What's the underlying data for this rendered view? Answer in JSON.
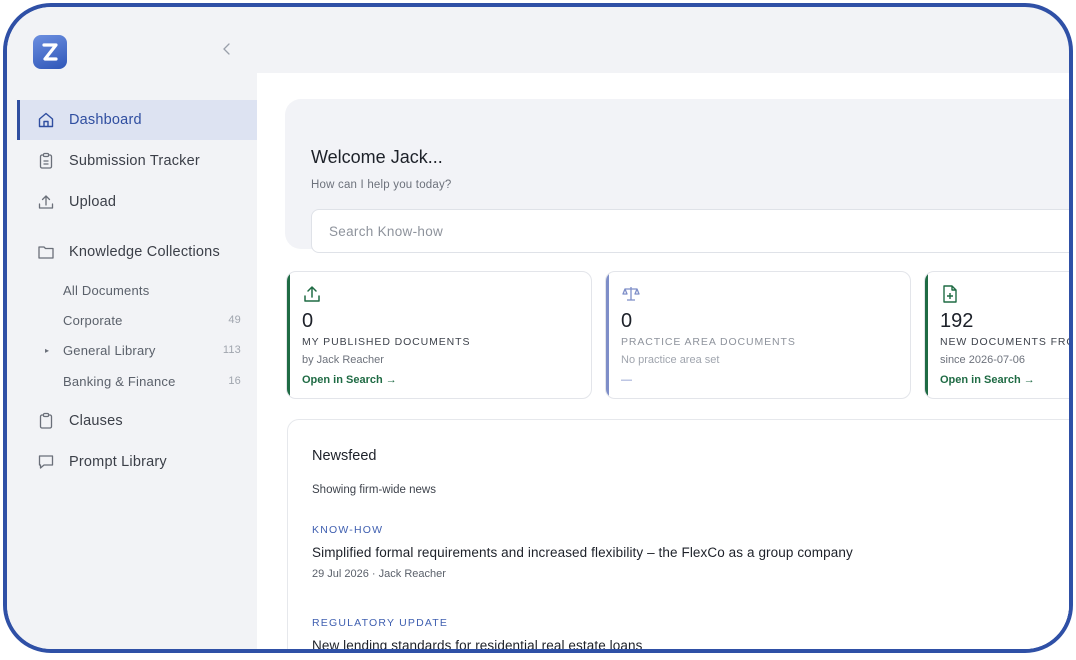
{
  "app": {
    "logo_text": "Z",
    "collapse_icon": "chevron-left-icon"
  },
  "sidebar": {
    "nav": [
      {
        "label": "Dashboard",
        "icon": "home-icon",
        "active": true
      },
      {
        "label": "Submission Tracker",
        "icon": "clipboard-icon"
      },
      {
        "label": "Upload",
        "icon": "upload-icon"
      },
      {
        "label": "Knowledge Collections",
        "icon": "folder-icon"
      }
    ],
    "collections": [
      {
        "label": "All Documents",
        "count": ""
      },
      {
        "label": "Corporate",
        "count": "49"
      },
      {
        "label": "General Library",
        "count": "113",
        "expandable": true
      },
      {
        "label": "Banking & Finance",
        "count": "16"
      }
    ],
    "bottom_nav": [
      {
        "label": "Clauses",
        "icon": "clipboard-icon"
      },
      {
        "label": "Prompt Library",
        "icon": "chat-icon"
      }
    ]
  },
  "welcome": {
    "title": "Welcome Jack...",
    "subtitle": "How can I help you today?",
    "search_placeholder": "Search Know-how"
  },
  "cards": [
    {
      "icon": "upload-icon",
      "value": "0",
      "label": "MY PUBLISHED DOCUMENTS",
      "desc": "by Jack Reacher",
      "link": "Open in Search →",
      "accent": "#1f6b44"
    },
    {
      "icon": "scales-icon",
      "value": "0",
      "label": "PRACTICE AREA DOCUMENTS",
      "desc": "No practice area set",
      "link": "—",
      "accent": "#7e8ec8"
    },
    {
      "icon": "file-plus-icon",
      "value": "192",
      "label": "NEW DOCUMENTS FRO",
      "desc": "since 2026-07-06",
      "link": "Open in Search →",
      "accent": "#1f6b44"
    }
  ],
  "newsfeed": {
    "title": "Newsfeed",
    "filter": "Showing firm-wide news",
    "items": [
      {
        "tag": "KNOW-HOW",
        "title": "Simplified formal requirements and increased flexibility – the FlexCo as a group company",
        "meta": "29 Jul 2026 · Jack Reacher"
      },
      {
        "tag": "REGULATORY UPDATE",
        "title": "New lending standards for residential real estate loans",
        "meta": ""
      }
    ]
  },
  "colors": {
    "frame": "#2f50a6",
    "brand": "#2f56b8",
    "active_bg": "#dde3f2",
    "accent_green": "#1f6b44",
    "accent_lilac": "#7e8ec8"
  }
}
